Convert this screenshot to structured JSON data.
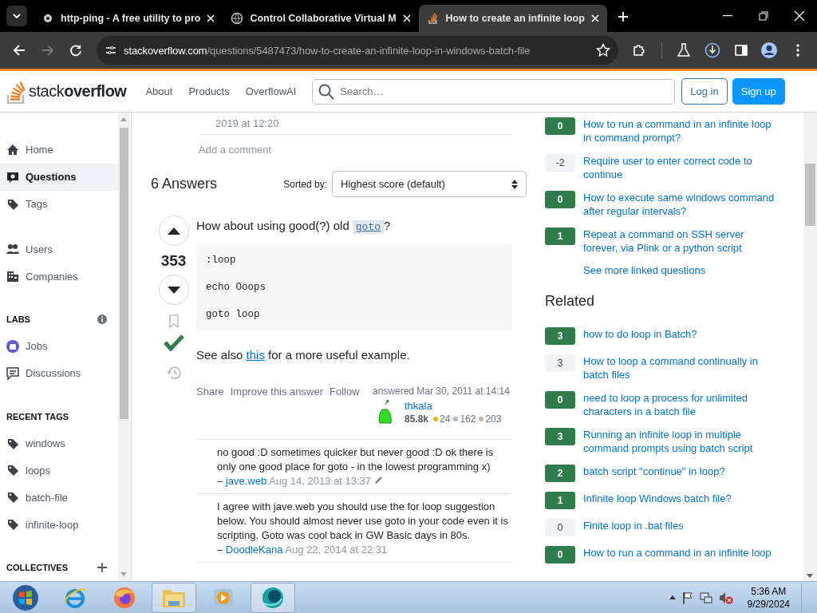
{
  "browser": {
    "tabs": [
      {
        "title": "http-ping - A free utility to pro",
        "selected": false
      },
      {
        "title": "Control Collaborative Virtual M",
        "selected": false
      },
      {
        "title": "How to create an infinite loop",
        "selected": true
      }
    ],
    "url": {
      "host": "stackoverflow.com",
      "path": "/questions/5487473/how-to-create-an-infinite-loop-in-windows-batch-file"
    }
  },
  "header": {
    "logo": "stack**overflow**",
    "nav": [
      "About",
      "Products",
      "OverflowAI"
    ],
    "search": {
      "placeholder": "Search…"
    },
    "buttons": [
      {
        "label": "Log in",
        "kind": "secondary"
      },
      {
        "label": "Sign up",
        "kind": "primary"
      }
    ]
  },
  "left_nav": {
    "primary": [
      {
        "label": "Home",
        "selected": false
      },
      {
        "label": "Questions",
        "selected": true
      },
      {
        "label": "Tags",
        "selected": false
      }
    ],
    "secondary": [
      {
        "label": "Users",
        "selected": false
      },
      {
        "label": "Companies",
        "selected": false
      }
    ],
    "labs": {
      "heading": "LABS",
      "items": [
        {
          "label": "Jobs",
          "selected": false
        },
        {
          "label": "Discussions",
          "selected": false
        }
      ]
    },
    "recent_tags": {
      "heading": "RECENT TAGS",
      "items": [
        "windows",
        "loops",
        "batch-file",
        "infinite-loop"
      ]
    },
    "collectives": {
      "heading": "COLLECTIVES"
    }
  },
  "question_tail": {
    "comment_date": "2019 at 12:20",
    "add_comment": "Add a comment"
  },
  "answers": {
    "title": "6 Answers",
    "sort_label": "Sorted by:",
    "sort_value": "Highest score (default)"
  },
  "answer": {
    "score": "353",
    "accepted": true,
    "intro": {
      "before": "How about using good(?) old",
      "code": "goto",
      "after": "?"
    },
    "code": [
      ":loop",
      "echo Ooops",
      "goto loop"
    ],
    "see_also": {
      "before": "See also",
      "link": "this",
      "after": "for a more useful example."
    },
    "actions": [
      "Share",
      "Improve this answer",
      "Follow"
    ],
    "signature": {
      "action": "answered Mar 30, 2011 at 14:14",
      "user": "thkala",
      "reputation": "85.8k",
      "badges": [
        {
          "count": "24",
          "color": "#f0b400"
        },
        {
          "count": "162",
          "color": "#b4b8bc"
        },
        {
          "count": "203",
          "color": "#c0b3a6"
        }
      ]
    },
    "comments": [
      {
        "text": "no good :D sometimes quicker but never good :D ok there is only one good place for goto - in the lowest programming x)",
        "separator": "–",
        "user": "jave.web",
        "date": "Aug 14, 2013 at 13:37",
        "edited": true
      },
      {
        "text": "I agree with jave.web you should use the for loop suggestion below. You should almost never use goto in your code even it is scripting. Goto was cool back in GW Basic days in 80s.",
        "separator": "–",
        "user": "DoodleKana",
        "date": "Aug 22, 2014 at 22:31",
        "edited": false
      }
    ]
  },
  "linked": {
    "items": [
      {
        "score": "0",
        "answered": true,
        "title": "How to run a command in an infinite loop in command prompt?"
      },
      {
        "score": "-2",
        "answered": false,
        "title": "Require user to enter correct code to continue"
      },
      {
        "score": "0",
        "answered": true,
        "title": "How to execute same windows command after regular intervals?"
      },
      {
        "score": "1",
        "answered": true,
        "title": "Repeat a command on SSH server forever, via Plink or a python script"
      }
    ],
    "more": "See more linked questions"
  },
  "related": {
    "heading": "Related",
    "items": [
      {
        "score": "3",
        "answered": true,
        "title": "how to do loop in Batch?"
      },
      {
        "score": "3",
        "answered": false,
        "title": "How to loop a command continually in batch files"
      },
      {
        "score": "0",
        "answered": true,
        "title": "need to loop a process for unlimited characters in a batch file"
      },
      {
        "score": "3",
        "answered": true,
        "title": "Running an infinite loop in multiple command prompts using batch script"
      },
      {
        "score": "2",
        "answered": true,
        "title": "batch script \"continue\" in loop?"
      },
      {
        "score": "1",
        "answered": true,
        "title": "Infinite loop Windows batch file?"
      },
      {
        "score": "0",
        "answered": false,
        "title": "Finite loop in .bat files"
      },
      {
        "score": "0",
        "answered": true,
        "title": "How to run a command in an infinite loop"
      }
    ]
  },
  "taskbar": {
    "time": "5:36 AM",
    "date": "9/29/2024"
  }
}
